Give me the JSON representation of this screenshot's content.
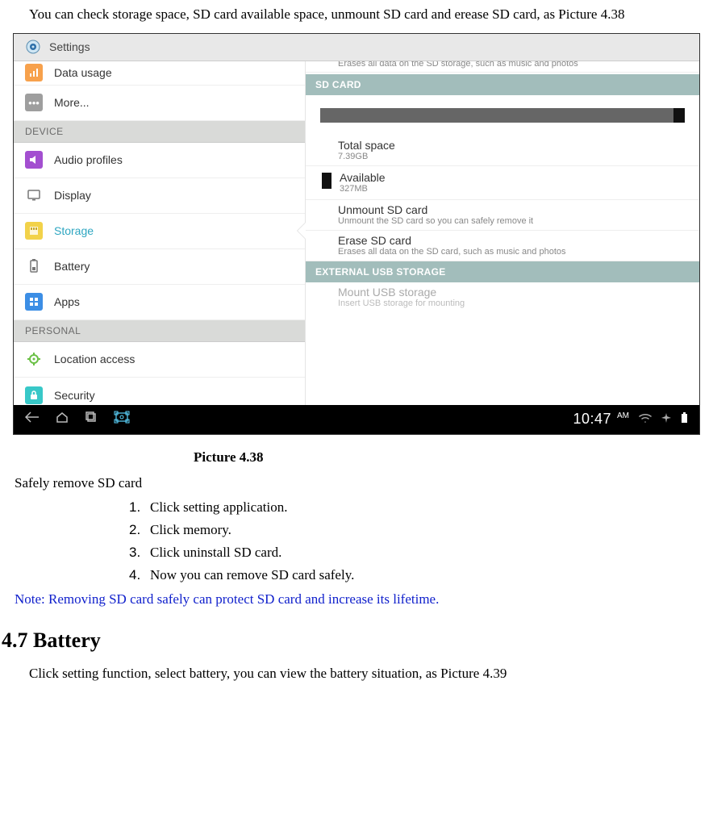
{
  "intro": "You can check storage space, SD card available space, unmount SD card and erease SD card, as Picture 4.38",
  "screenshot": {
    "header_title": "Settings",
    "left": {
      "data_usage": "Data usage",
      "more": "More...",
      "section_device": "DEVICE",
      "audio_profiles": "Audio profiles",
      "display": "Display",
      "storage": "Storage",
      "battery": "Battery",
      "apps": "Apps",
      "section_personal": "PERSONAL",
      "location_access": "Location access",
      "security": "Security"
    },
    "right": {
      "truncated_line": "Erases all data on the SD storage, such as music and photos",
      "sd_card_header": "SD CARD",
      "total_space_label": "Total space",
      "total_space_value": "7.39GB",
      "available_label": "Available",
      "available_value": "327MB",
      "unmount_label": "Unmount SD card",
      "unmount_sub": "Unmount the SD card so you can safely remove it",
      "erase_label": "Erase SD card",
      "erase_sub": "Erases all data on the SD card, such as music and photos",
      "ext_usb_header": "EXTERNAL USB STORAGE",
      "mount_usb_label": "Mount USB storage",
      "mount_usb_sub": "Insert USB storage for mounting"
    },
    "navbar": {
      "time": "10:47",
      "ampm": "AM"
    }
  },
  "caption": "Picture  4.38",
  "safely_remove_heading": "Safely remove SD card",
  "steps": {
    "s1": "Click setting application.",
    "s2": "Click memory.",
    "s3": "Click uninstall SD card.",
    "s4": "Now you can remove SD card safely."
  },
  "note": "Note: Removing SD card safely can protect SD card and increase its lifetime.",
  "section_battery": "4.7 Battery",
  "closing": "Click setting function, select battery, you can view the battery situation, as Picture 4.39"
}
